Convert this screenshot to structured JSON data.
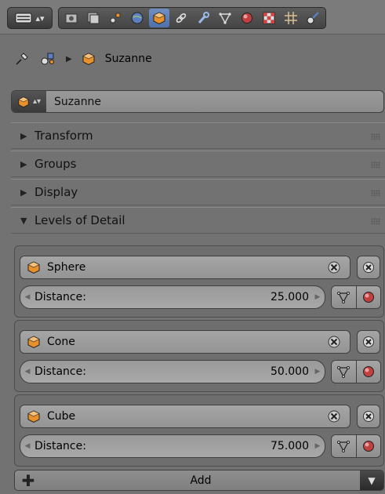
{
  "header": {
    "tabs": [
      {
        "icon": "render-icon"
      },
      {
        "icon": "render-layers-icon"
      },
      {
        "icon": "scene-icon"
      },
      {
        "icon": "world-icon"
      },
      {
        "icon": "object-icon",
        "active": true
      },
      {
        "icon": "constraints-icon"
      },
      {
        "icon": "modifiers-icon"
      },
      {
        "icon": "data-icon"
      },
      {
        "icon": "material-icon"
      },
      {
        "icon": "texture-icon"
      },
      {
        "icon": "particles-icon"
      },
      {
        "icon": "physics-icon"
      }
    ]
  },
  "breadcrumb": {
    "object_name": "Suzanne"
  },
  "object_field": {
    "value": "Suzanne"
  },
  "panels": {
    "transform": "Transform",
    "groups": "Groups",
    "display": "Display",
    "lod": "Levels of Detail"
  },
  "lod_levels": [
    {
      "object": "Sphere",
      "distance_label": "Distance:",
      "distance": "25.000"
    },
    {
      "object": "Cone",
      "distance_label": "Distance:",
      "distance": "50.000"
    },
    {
      "object": "Cube",
      "distance_label": "Distance:",
      "distance": "75.000"
    }
  ],
  "add_button": {
    "label": "Add"
  },
  "colors": {
    "active_tab": "#5b7fc0",
    "object_orange": "#e8902a",
    "panel_bg": "#727272"
  }
}
